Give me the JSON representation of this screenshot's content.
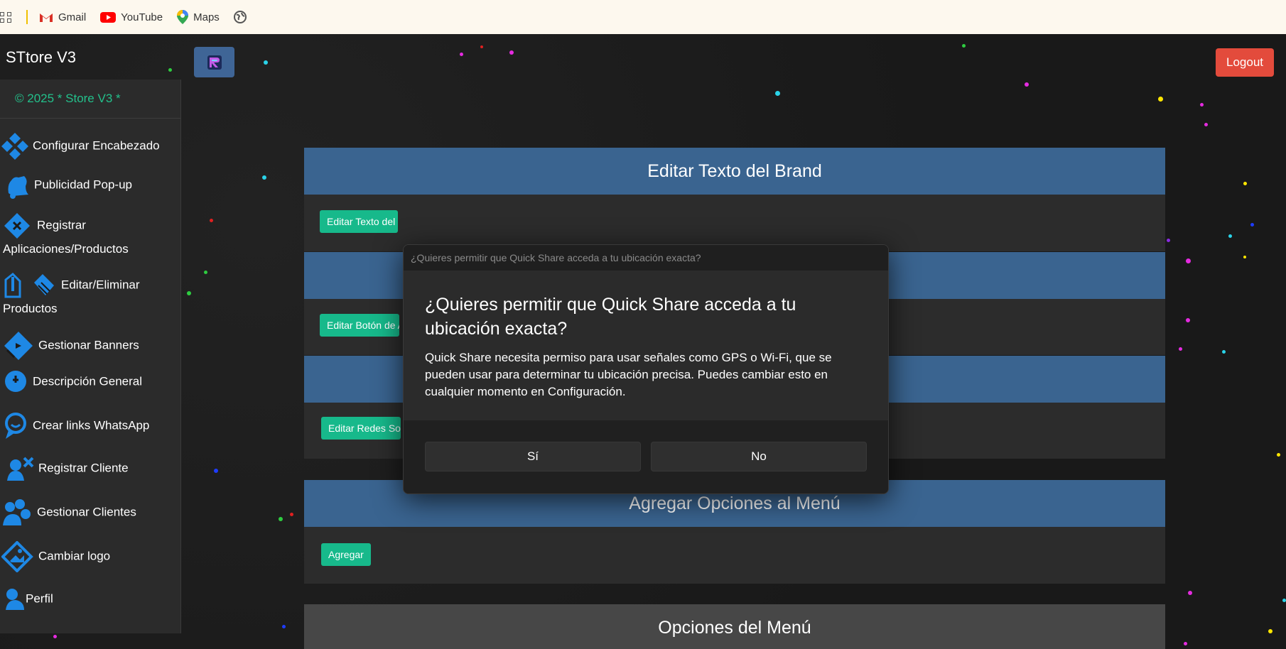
{
  "bookmarks": {
    "items": [
      {
        "label": "Gmail",
        "icon": "gmail-icon"
      },
      {
        "label": "YouTube",
        "icon": "youtube-icon"
      },
      {
        "label": "Maps",
        "icon": "maps-icon"
      }
    ]
  },
  "header": {
    "brand": "STtore V3",
    "logout_label": "Logout"
  },
  "sidebar": {
    "copyright": "© 2025 * Store V3 *",
    "items": [
      {
        "label": "Configurar Encabezado",
        "icon": "layers-icon"
      },
      {
        "label": "Publicidad Pop-up",
        "icon": "bell-icon"
      },
      {
        "label": "Registrar Aplicaciones/Productos",
        "icon": "register-product-icon"
      },
      {
        "label": "Editar/Eliminar Productos",
        "icon": "edit-delete-icon"
      },
      {
        "label": "Gestionar Banners",
        "icon": "banner-icon"
      },
      {
        "label": "Descripción General",
        "icon": "description-icon"
      },
      {
        "label": "Crear links WhatsApp",
        "icon": "whatsapp-icon"
      },
      {
        "label": "Registrar Cliente",
        "icon": "add-user-icon"
      },
      {
        "label": "Gestionar Clientes",
        "icon": "users-icon"
      },
      {
        "label": "Cambiar logo",
        "icon": "image-icon"
      },
      {
        "label": "Perfil",
        "icon": "profile-icon"
      }
    ]
  },
  "main": {
    "panels": [
      {
        "title": "Editar Texto del Brand",
        "button": "Editar Texto del Brand"
      },
      {
        "title": "",
        "button": "Editar Botón de Acción"
      },
      {
        "title": "",
        "button": "Editar Redes Sociales"
      },
      {
        "title": "Agregar Opciones al Menú",
        "button": "Agregar"
      },
      {
        "title": "Opciones del Menú"
      }
    ]
  },
  "dialog": {
    "titlebar": "¿Quieres permitir que Quick Share acceda a tu ubicación exacta?",
    "heading": "¿Quieres permitir que Quick Share acceda a tu ubicación exacta?",
    "body": "Quick Share necesita permiso para usar señales como GPS o Wi-Fi, que se pueden usar para determinar tu ubicación precisa. Puedes cambiar esto en cualquier momento en Configuración.",
    "yes_label": "Sí",
    "no_label": "No"
  },
  "colors": {
    "accent_blue": "#3a6490",
    "green_button": "#17b98b",
    "logout_red": "#e34b3c",
    "copyright_green": "#23c08b"
  }
}
